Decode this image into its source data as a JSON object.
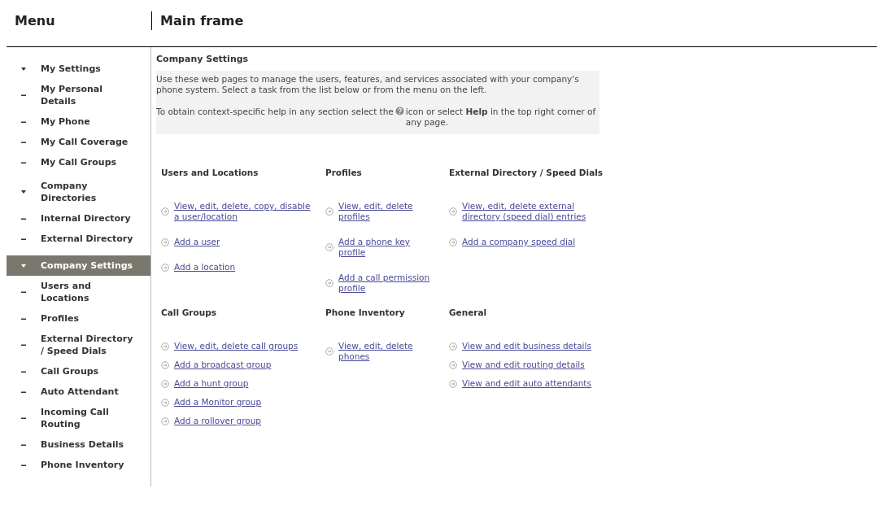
{
  "header": {
    "menu_title": "Menu",
    "main_title": "Main frame"
  },
  "menu": [
    {
      "kind": "group",
      "label": "My Settings",
      "selected": false
    },
    {
      "kind": "item",
      "label": "My Personal Details",
      "selected": false
    },
    {
      "kind": "item",
      "label": "My Phone",
      "selected": false
    },
    {
      "kind": "item",
      "label": "My Call Coverage",
      "selected": false
    },
    {
      "kind": "item",
      "label": "My Call Groups",
      "selected": false
    },
    {
      "kind": "group",
      "label": "Company Directories",
      "selected": false
    },
    {
      "kind": "item",
      "label": "Internal Directory",
      "selected": false
    },
    {
      "kind": "item",
      "label": "External Directory",
      "selected": false
    },
    {
      "kind": "group",
      "label": "Company Settings",
      "selected": true
    },
    {
      "kind": "item",
      "label": "Users and Locations",
      "selected": false
    },
    {
      "kind": "item",
      "label": "Profiles",
      "selected": false
    },
    {
      "kind": "item",
      "label": "External Directory / Speed Dials",
      "selected": false
    },
    {
      "kind": "item",
      "label": "Call Groups",
      "selected": false
    },
    {
      "kind": "item",
      "label": "Auto Attendant",
      "selected": false
    },
    {
      "kind": "item",
      "label": "Incoming Call Routing",
      "selected": false
    },
    {
      "kind": "item",
      "label": "Business Details",
      "selected": false
    },
    {
      "kind": "item",
      "label": "Phone Inventory",
      "selected": false
    }
  ],
  "page": {
    "title": "Company Settings",
    "intro": "Use these web pages to manage the users, features, and services associated with your company's phone system. Select a task from the list below or from the menu on the left.",
    "help_before": "To obtain context-specific help in any section select the",
    "help_after": "icon or select **Help** in the top right corner of any page.",
    "sections": [
      {
        "heading": "Users and Locations",
        "links": [
          "View, edit, delete, copy, disable a user/location",
          "Add a user",
          "Add a location"
        ]
      },
      {
        "heading": "Profiles",
        "links": [
          "View, edit, delete profiles",
          "Add a phone key profile",
          "Add a call permission profile"
        ]
      },
      {
        "heading": "External Directory / Speed Dials",
        "links": [
          "View, edit, delete external directory (speed dial) entries",
          "Add a company speed dial"
        ]
      },
      {
        "heading": "Call Groups",
        "links": [
          "View, edit, delete call groups",
          "Add a broadcast group",
          "Add a hunt group",
          "Add a Monitor group",
          "Add a rollover group"
        ]
      },
      {
        "heading": "Phone Inventory",
        "links": [
          "View, edit, delete phones"
        ]
      },
      {
        "heading": "General",
        "links": [
          "View and edit business details",
          "View and edit routing details",
          "View and edit auto attendants"
        ]
      }
    ]
  }
}
